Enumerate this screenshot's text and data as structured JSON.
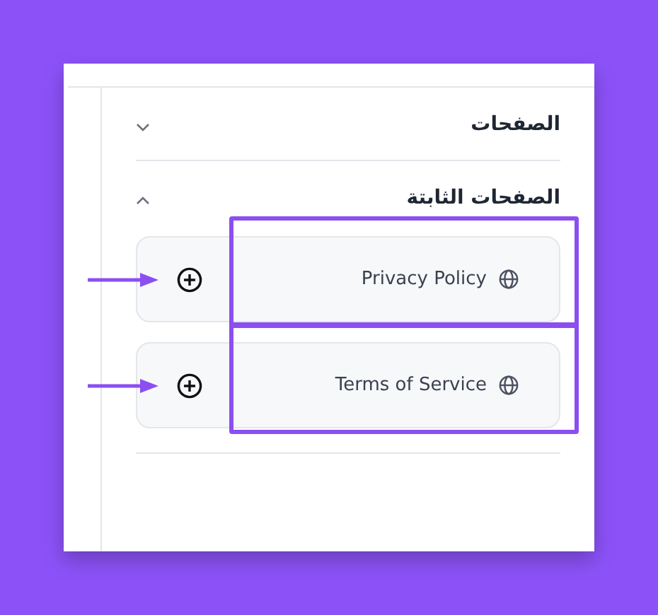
{
  "sections": [
    {
      "title": "الصفحات",
      "expanded": false
    },
    {
      "title": "الصفحات الثابتة",
      "expanded": true,
      "items": [
        {
          "label": "Privacy Policy",
          "highlighted": true
        },
        {
          "label": "Terms of Service",
          "highlighted": true
        }
      ]
    }
  ]
}
